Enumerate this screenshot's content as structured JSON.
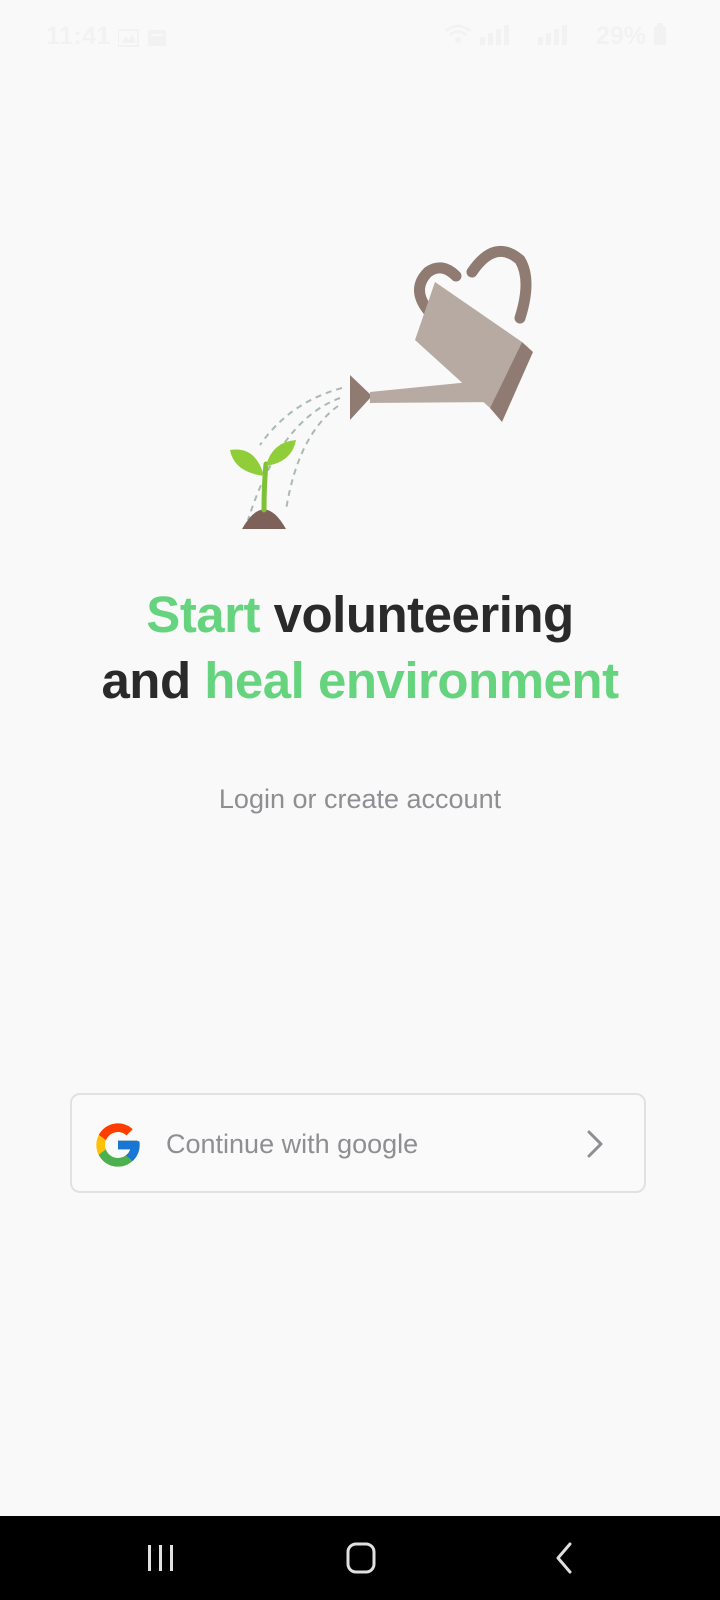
{
  "status_bar": {
    "time": "11:41",
    "battery_percent": "29%"
  },
  "icons": {
    "illustration": "watering-can-sprout-illustration",
    "google": "google-g-icon",
    "chevron": "chevron-right-icon",
    "nav_recents": "recent-apps-icon",
    "nav_home": "home-icon",
    "nav_back": "back-icon"
  },
  "headline": {
    "part1": "Start",
    "part2": " volunteering",
    "part3": "and ",
    "part4": "heal environment"
  },
  "subtitle": "Login or create account",
  "google_button": {
    "label": "Continue with google"
  },
  "colors": {
    "accent_green": "#66d47f",
    "heading_dark": "#2a2a2a",
    "muted_text": "#8e8e93",
    "watering_can": "#b6aaa2",
    "watering_can_dark": "#8f7b71",
    "soil": "#7e6158",
    "leaf": "#8fce38"
  }
}
